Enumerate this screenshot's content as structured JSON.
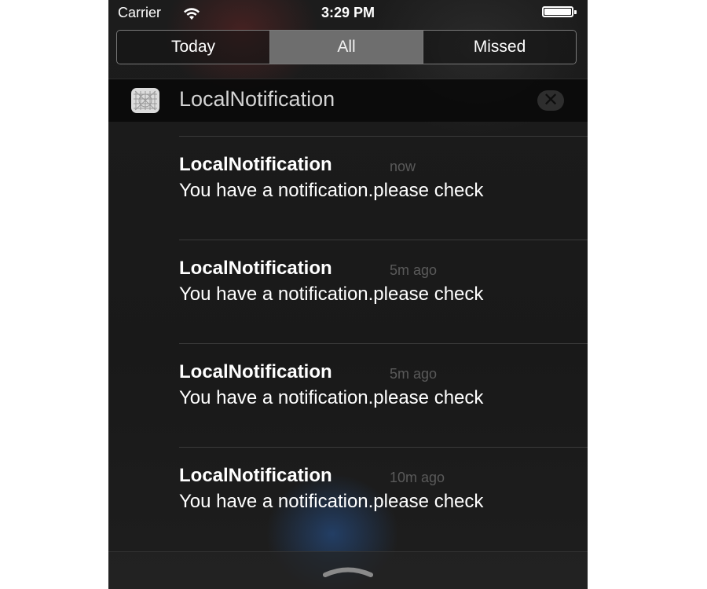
{
  "status_bar": {
    "carrier": "Carrier",
    "time": "3:29 PM",
    "wifi_icon": "wifi-icon",
    "battery_icon": "battery-full-icon"
  },
  "tabs": [
    {
      "label": "Today",
      "selected": false
    },
    {
      "label": "All",
      "selected": true
    },
    {
      "label": "Missed",
      "selected": false
    }
  ],
  "app_section": {
    "title": "LocalNotification",
    "icon": "app-grid-icon",
    "clear_icon": "close-icon"
  },
  "notifications": [
    {
      "title": "LocalNotification",
      "time": "now",
      "body": "You have a notification.please check"
    },
    {
      "title": "LocalNotification",
      "time": "5m ago",
      "body": "You have a notification.please check"
    },
    {
      "title": "LocalNotification",
      "time": "5m ago",
      "body": "You have a notification.please check"
    },
    {
      "title": "LocalNotification",
      "time": "10m ago",
      "body": "You have a notification.please check"
    }
  ],
  "bottom": {
    "grabber_icon": "chevron-up-handle-icon"
  },
  "colors": {
    "background": "#1b1b1b",
    "segment_selected": "#6e6e6e",
    "timestamp": "#5a5a5a"
  }
}
